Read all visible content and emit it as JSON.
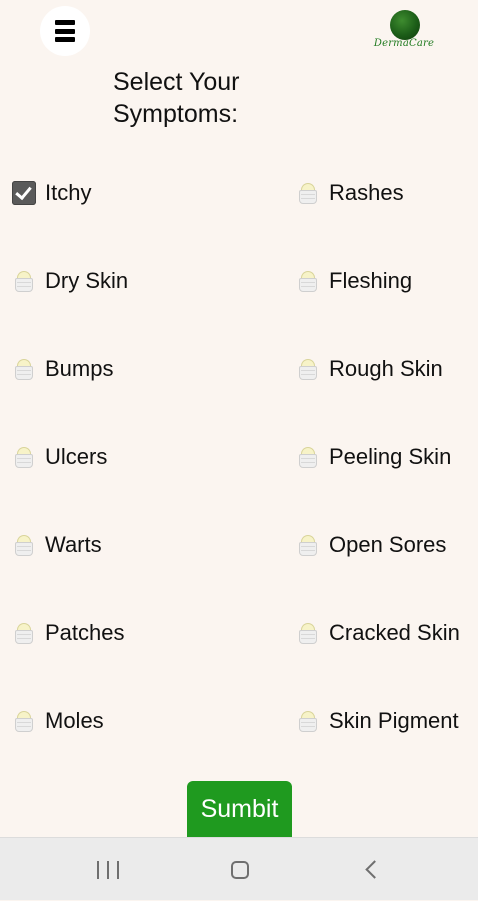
{
  "header": {
    "menu_icon": "hamburger-menu-icon",
    "logo_text": "DermaCare",
    "logo_color": "#1f7a1f"
  },
  "page": {
    "title_line1": "Select Your",
    "title_line2": "Symptoms:"
  },
  "symptoms": {
    "left": [
      {
        "label": "Itchy",
        "checked": true
      },
      {
        "label": "Dry Skin",
        "checked": false
      },
      {
        "label": "Bumps",
        "checked": false
      },
      {
        "label": "Ulcers",
        "checked": false
      },
      {
        "label": "Warts",
        "checked": false
      },
      {
        "label": "Patches",
        "checked": false
      },
      {
        "label": "Moles",
        "checked": false
      }
    ],
    "right": [
      {
        "label": "Rashes",
        "checked": false
      },
      {
        "label": "Fleshing",
        "checked": false
      },
      {
        "label": "Rough Skin",
        "checked": false
      },
      {
        "label": "Peeling Skin",
        "checked": false
      },
      {
        "label": "Open Sores",
        "checked": false
      },
      {
        "label": "Cracked Skin",
        "checked": false
      },
      {
        "label": "Skin Pigment",
        "checked": false
      }
    ]
  },
  "submit": {
    "label": "Sumbit",
    "color": "#1f9a1f"
  },
  "navbar": {
    "recents_icon": "recents-icon",
    "home_icon": "home-icon",
    "back_icon": "back-icon"
  },
  "colors": {
    "background": "#fbf5f0",
    "accent": "#1f9a1f"
  }
}
